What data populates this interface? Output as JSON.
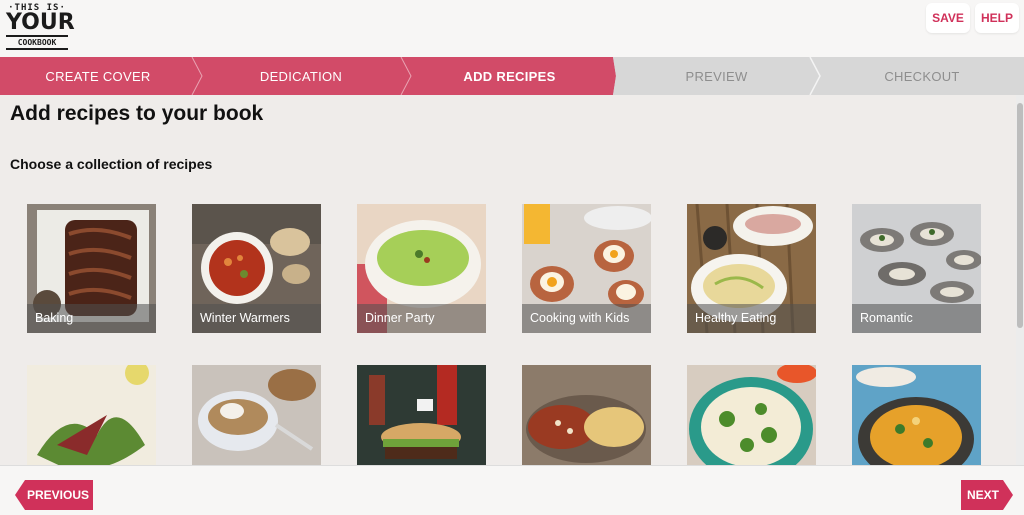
{
  "logo": {
    "line1": "·THIS IS·",
    "line2": "YOUR",
    "line3": "COOKBOOK"
  },
  "topbar": {
    "save_label": "SAVE",
    "help_label": "HELP"
  },
  "steps": [
    {
      "label": "CREATE COVER",
      "state": "done"
    },
    {
      "label": "DEDICATION",
      "state": "done"
    },
    {
      "label": "ADD RECIPES",
      "state": "active"
    },
    {
      "label": "PREVIEW",
      "state": "todo"
    },
    {
      "label": "CHECKOUT",
      "state": "todo"
    }
  ],
  "main": {
    "title": "Add recipes to your book",
    "subtitle": "Choose a collection of recipes",
    "collections": [
      {
        "label": "Baking"
      },
      {
        "label": "Winter Warmers"
      },
      {
        "label": "Dinner Party"
      },
      {
        "label": "Cooking with Kids"
      },
      {
        "label": "Healthy Eating"
      },
      {
        "label": "Romantic"
      }
    ]
  },
  "footer": {
    "previous_label": "PREVIOUS",
    "next_label": "NEXT"
  },
  "colors": {
    "brand": "#d24b68",
    "brand_text": "#d0315a",
    "inactive_step": "#d7d7d7"
  }
}
